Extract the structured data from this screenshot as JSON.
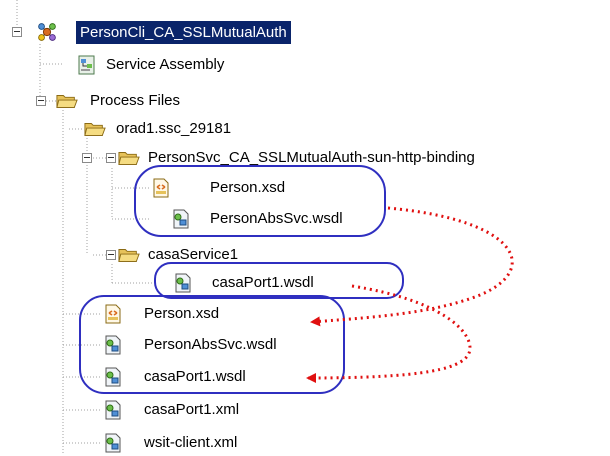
{
  "tree": {
    "root": {
      "label": "PersonCli_CA_SSLMutualAuth",
      "icon": "project-molecule-icon"
    },
    "service_assembly": {
      "label": "Service Assembly",
      "icon": "service-assembly-icon"
    },
    "process_files": {
      "label": "Process Files",
      "icon": "folder-open-icon"
    },
    "orad1": {
      "label": "orad1.ssc_29181",
      "icon": "folder-open-icon"
    },
    "personsvc_folder": {
      "label": "PersonSvc_CA_SSLMutualAuth-sun-http-binding",
      "icon": "folder-open-icon"
    },
    "personsvc_files": [
      {
        "label": "Person.xsd",
        "icon": "xsd-file-icon"
      },
      {
        "label": "PersonAbsSvc.wsdl",
        "icon": "wsdl-file-icon"
      }
    ],
    "casa_folder": {
      "label": "casaService1",
      "icon": "folder-open-icon"
    },
    "casa_files": [
      {
        "label": "casaPort1.wsdl",
        "icon": "wsdl-file-icon"
      }
    ],
    "process_root_files": [
      {
        "label": "Person.xsd",
        "icon": "xsd-file-icon"
      },
      {
        "label": "PersonAbsSvc.wsdl",
        "icon": "wsdl-file-icon"
      },
      {
        "label": "casaPort1.wsdl",
        "icon": "wsdl-file-icon"
      },
      {
        "label": "casaPort1.xml",
        "icon": "xml-file-icon"
      },
      {
        "label": "wsit-client.xml",
        "icon": "xml-file-icon"
      }
    ]
  },
  "annotation": {
    "ellipse_color": "#2f2fc0",
    "arrow_color": "#e01010"
  }
}
